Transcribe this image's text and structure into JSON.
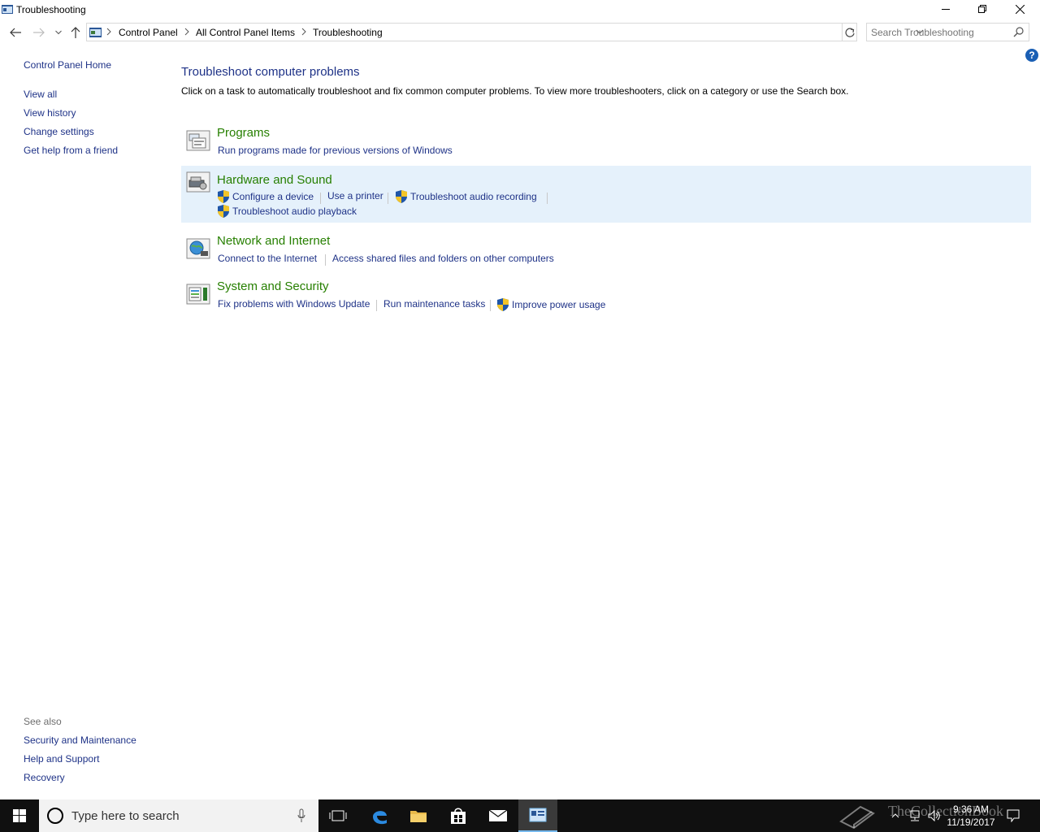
{
  "window": {
    "title": "Troubleshooting",
    "minimize_icon": "minimize-icon",
    "restore_icon": "restore-icon",
    "close_icon": "close-icon"
  },
  "nav": {
    "breadcrumbs": [
      "Control Panel",
      "All Control Panel Items",
      "Troubleshooting"
    ],
    "search_placeholder": "Search Troubleshooting"
  },
  "sidebar": {
    "home": "Control Panel Home",
    "links": [
      "View all",
      "View history",
      "Change settings",
      "Get help from a friend"
    ],
    "see_also_label": "See also",
    "see_also": [
      "Security and Maintenance",
      "Help and Support",
      "Recovery"
    ]
  },
  "main": {
    "title": "Troubleshoot computer problems",
    "description": "Click on a task to automatically troubleshoot and fix common computer problems. To view more troubleshooters, click on a category or use the Search box.",
    "categories": [
      {
        "title": "Programs",
        "icon": "programs-icon",
        "tasks": [
          "Run programs made for previous versions of Windows"
        ]
      },
      {
        "title": "Hardware and Sound",
        "icon": "hardware-sound-icon",
        "highlighted": true,
        "tasks": [
          "Configure a device",
          "Use a printer",
          "Troubleshoot audio recording",
          "Troubleshoot audio playback"
        ]
      },
      {
        "title": "Network and Internet",
        "icon": "network-icon",
        "tasks": [
          "Connect to the Internet",
          "Access shared files and folders on other computers"
        ]
      },
      {
        "title": "System and Security",
        "icon": "system-security-icon",
        "tasks": [
          "Fix problems with Windows Update",
          "Run maintenance tasks",
          "Improve power usage"
        ]
      }
    ]
  },
  "taskbar": {
    "search_placeholder": "Type here to search",
    "time": "9:36 AM",
    "date": "11/19/2017",
    "watermark": "TheCollectionBook"
  },
  "colors": {
    "link": "#1e3287",
    "category_title": "#267f00",
    "highlight": "#e5f1fb",
    "taskbar": "#101010"
  }
}
